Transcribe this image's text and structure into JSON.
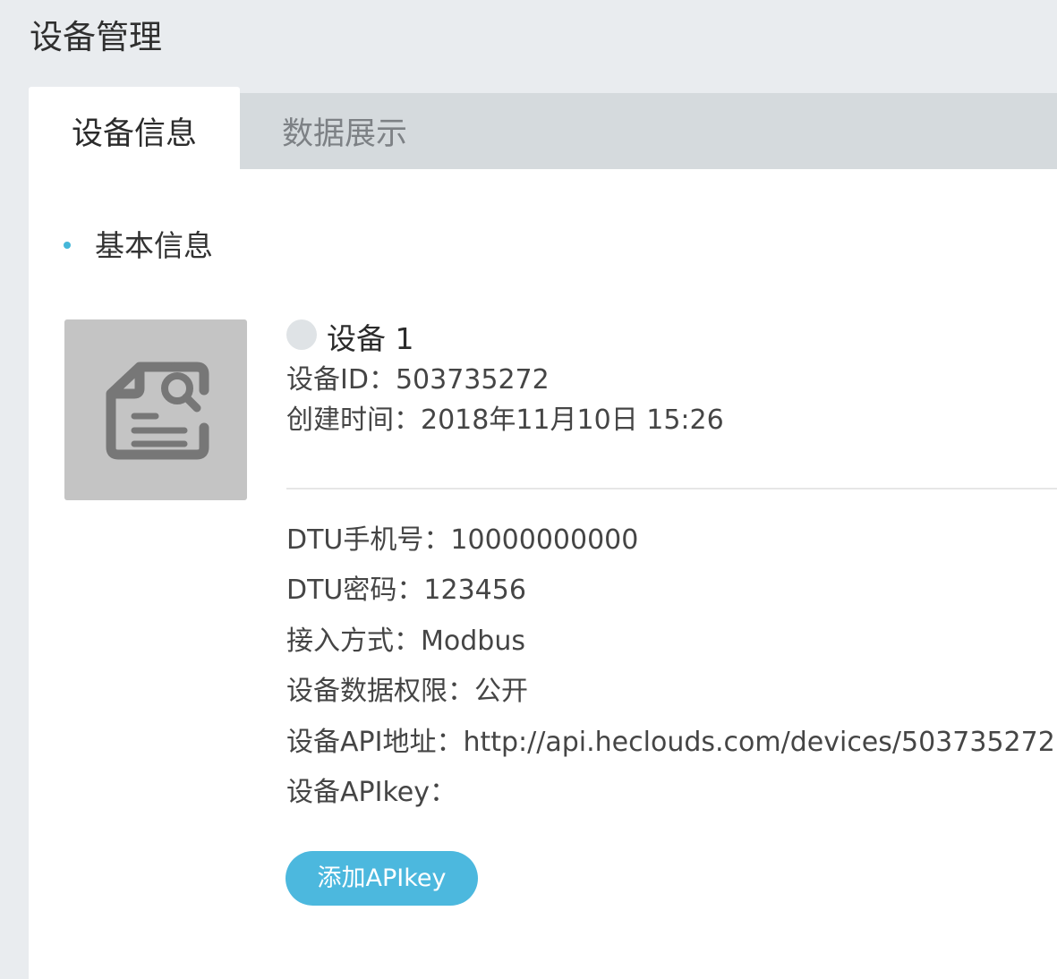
{
  "page": {
    "title": "设备管理"
  },
  "tabs": [
    {
      "label": "设备信息",
      "active": true
    },
    {
      "label": "数据展示",
      "active": false
    }
  ],
  "section": {
    "title": "基本信息"
  },
  "device": {
    "icon": "document-search-icon",
    "status_color": "#dfe3e6",
    "name": "设备 1",
    "id_label": "设备ID：",
    "id": "503735272",
    "created_label": "创建时间：",
    "created": "2018年11月10日 15:26"
  },
  "details": [
    {
      "label": "DTU手机号：",
      "value": "10000000000"
    },
    {
      "label": "DTU密码：",
      "value": "123456"
    },
    {
      "label": "接入方式：",
      "value": "Modbus"
    },
    {
      "label": "设备数据权限：",
      "value": "公开"
    },
    {
      "label": "设备API地址：",
      "value": "http://api.heclouds.com/devices/503735272"
    },
    {
      "label": "设备APIkey：",
      "value": ""
    }
  ],
  "actions": {
    "add_apikey_label": "添加APIkey"
  },
  "colors": {
    "accent": "#4cb8de",
    "background": "#e9ecef",
    "panel": "#ffffff",
    "tab_strip": "#d5dadd"
  }
}
